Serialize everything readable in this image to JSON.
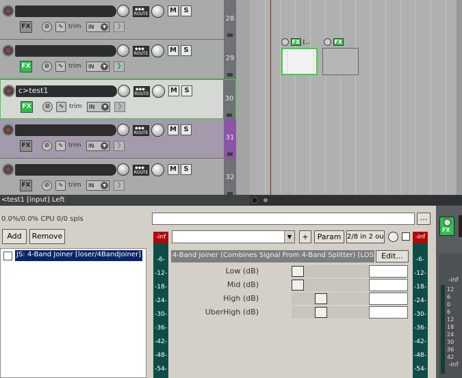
{
  "tracks": [
    {
      "num": "28",
      "name": "",
      "fx_on": false,
      "monitor_on": false,
      "purple": false,
      "selected": false
    },
    {
      "num": "29",
      "name": "",
      "fx_on": true,
      "monitor_on": true,
      "purple": false,
      "selected": false
    },
    {
      "num": "30",
      "name": "c>test1",
      "fx_on": true,
      "monitor_on": false,
      "purple": false,
      "selected": true
    },
    {
      "num": "31",
      "name": "",
      "fx_on": false,
      "monitor_on": false,
      "purple": true,
      "selected": false
    },
    {
      "num": "32",
      "name": "",
      "fx_on": false,
      "monitor_on": false,
      "purple": false,
      "selected": false
    }
  ],
  "track_labels": {
    "route": "ROUTE",
    "mute": "M",
    "solo": "S",
    "fx": "FX",
    "trim": "trim",
    "input": "IN"
  },
  "arrange": {
    "item1_label": "[...",
    "fx": "FX"
  },
  "status_bar": "<test1 [input] Left",
  "fx_window": {
    "cpu_text": "0.0%/0.0% CPU 0/0 spls",
    "add_label": "Add",
    "remove_label": "Remove",
    "fx_list": [
      {
        "name": "JS: 4-Band Joiner [loser/4BandJoiner]",
        "checked": false
      }
    ],
    "preset_value": "",
    "plus_label": "+",
    "param_label": "Param",
    "io_label": "2/8 in 2 out",
    "plugin_description": "4-Band Joiner (Combines Signal From 4-Band Splitter) [LOSER]",
    "edit_label": "Edit...",
    "dots_label": "...",
    "params": [
      {
        "label": "Low (dB)",
        "value": "",
        "level": 0.0
      },
      {
        "label": "Mid (dB)",
        "value": "",
        "level": 0.0
      },
      {
        "label": "High (dB)",
        "value": "",
        "level": 0.36
      },
      {
        "label": "UberHigh (dB)",
        "value": "",
        "level": 0.36
      }
    ],
    "meter_header": "-inf",
    "meter_ticks": [
      "-6-",
      "-12-",
      "-18-",
      "-24-",
      "-30-",
      "-36-",
      "-42-",
      "-48-",
      "-54-"
    ]
  },
  "mixer": {
    "fx": "FX",
    "inf_top": "-inf",
    "inf_bottom": "-inf",
    "ticks": [
      "12",
      "6",
      "0",
      "6",
      "12",
      "18",
      "24",
      "30",
      "36",
      "42"
    ]
  },
  "colors": {
    "fx_on": "#2ec04a",
    "selection_border": "#37d437",
    "meter_peak": "#b40707",
    "meter_bg": "#0e4d47",
    "purple_track": "#8a55a8",
    "list_selection": "#0a246a"
  }
}
